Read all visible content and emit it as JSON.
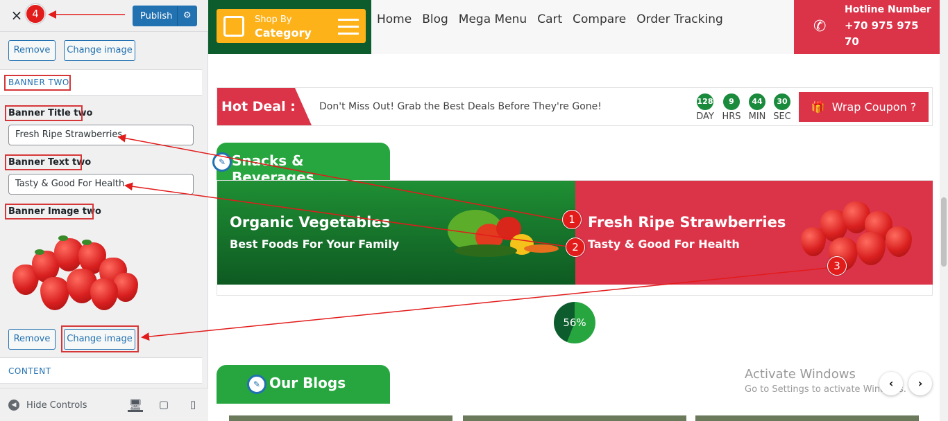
{
  "sidebar": {
    "close_label": "×",
    "publish_label": "Publish",
    "top_buttons": {
      "remove": "Remove",
      "change": "Change image"
    },
    "section_banner_two": "BANNER TWO",
    "banner_title_label": "Banner Title two",
    "banner_title_value": "Fresh Ripe Strawberries",
    "banner_text_label": "Banner Text two",
    "banner_text_value": "Tasty & Good For Health",
    "banner_image_label": "Banner Image two",
    "bottom_buttons": {
      "remove": "Remove",
      "change": "Change image"
    },
    "section_content": "CONTENT",
    "hide_controls": "Hide Controls"
  },
  "header": {
    "shop_by": "Shop By",
    "category": "Category",
    "nav": [
      "Home",
      "Blog",
      "Mega Menu",
      "Cart",
      "Compare",
      "Order Tracking"
    ],
    "hotline_title": "Hotline Number",
    "hotline_number": "+70 975 975 70"
  },
  "hotdeal": {
    "tag": "Hot Deal :",
    "text": "Don't Miss Out! Grab the Best Deals Before They're Gone!",
    "countdown": [
      {
        "value": "128",
        "unit": "DAY"
      },
      {
        "value": "9",
        "unit": "HRS"
      },
      {
        "value": "44",
        "unit": "MIN"
      },
      {
        "value": "30",
        "unit": "SEC"
      }
    ],
    "coupon": "Wrap Coupon ?"
  },
  "section_snacks": "Snacks & Beverages",
  "banner_one": {
    "title": "Organic Vegetables",
    "text": "Best Foods For Your Family"
  },
  "banner_two": {
    "title": "Fresh Ripe Strawberries",
    "text": "Tasty & Good For Health"
  },
  "progress": {
    "label": "56%",
    "value": 0.56
  },
  "section_blogs": "Our Blogs",
  "watermark": {
    "line1": "Activate Windows",
    "line2": "Go to Settings to activate Windows."
  },
  "annotations": [
    "1",
    "2",
    "3",
    "4"
  ],
  "colors": {
    "accent_red": "#db3449",
    "green": "#27a640",
    "dark_green": "#0d5c2e",
    "wp_blue": "#2271b1",
    "orange": "#fdb21a"
  }
}
